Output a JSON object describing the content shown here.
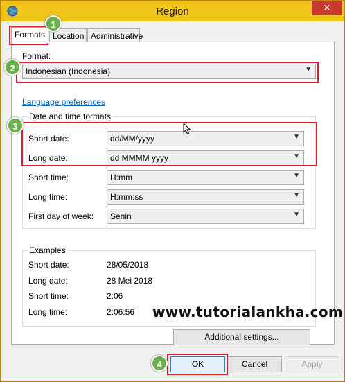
{
  "window": {
    "title": "Region",
    "close_label": "✕"
  },
  "tabs": [
    {
      "label": "Formats"
    },
    {
      "label": "Location"
    },
    {
      "label": "Administrative"
    }
  ],
  "format": {
    "label": "Format:",
    "value": "Indonesian (Indonesia)"
  },
  "language_link": "Language preferences",
  "datetime": {
    "title": "Date and time formats",
    "rows": [
      {
        "label": "Short date:",
        "value": "dd/MM/yyyy"
      },
      {
        "label": "Long date:",
        "value": "dd MMMM yyyy"
      },
      {
        "label": "Short time:",
        "value": "H:mm"
      },
      {
        "label": "Long time:",
        "value": "H:mm:ss"
      },
      {
        "label": "First day of week:",
        "value": "Senin"
      }
    ]
  },
  "examples": {
    "title": "Examples",
    "rows": [
      {
        "label": "Short date:",
        "value": "28/05/2018"
      },
      {
        "label": "Long date:",
        "value": "28 Mei 2018"
      },
      {
        "label": "Short time:",
        "value": "2:06"
      },
      {
        "label": "Long time:",
        "value": "2:06:56"
      }
    ]
  },
  "additional_settings": "Additional settings...",
  "buttons": {
    "ok": "OK",
    "cancel": "Cancel",
    "apply": "Apply"
  },
  "annotations": {
    "badge1": "1",
    "badge2": "2",
    "badge3": "3",
    "badge4": "4"
  },
  "watermark": "www.tutorialankha.com",
  "colors": {
    "highlight": "#e01e2b",
    "badge": "#6ab04c",
    "titlebar": "#f0c419",
    "close": "#c7392e",
    "link": "#0066cc"
  }
}
